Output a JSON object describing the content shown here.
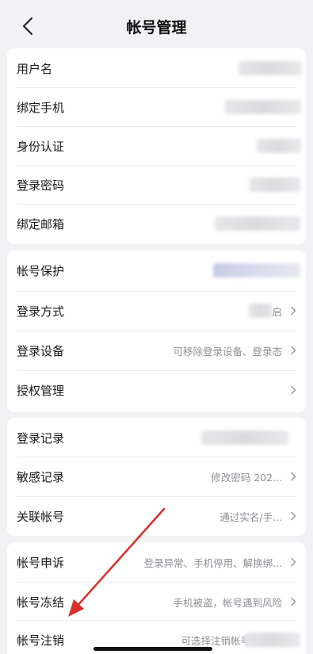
{
  "header": {
    "title": "帐号管理",
    "back_icon": "chevron-left-icon"
  },
  "groups": [
    {
      "rows": [
        {
          "label": "用户名",
          "value": ""
        },
        {
          "label": "绑定手机",
          "value": ""
        },
        {
          "label": "身份认证",
          "value": ""
        },
        {
          "label": "登录密码",
          "value": ""
        },
        {
          "label": "绑定邮箱",
          "value": ""
        }
      ]
    },
    {
      "rows": [
        {
          "label": "帐号保护",
          "value": ""
        },
        {
          "label": "登录方式",
          "value": "启"
        },
        {
          "label": "登录设备",
          "value": "可移除登录设备、登录态"
        },
        {
          "label": "授权管理",
          "value": ""
        }
      ]
    },
    {
      "rows": [
        {
          "label": "登录记录",
          "value": ""
        },
        {
          "label": "敏感记录",
          "value": "修改密码 202..."
        },
        {
          "label": "关联帐号",
          "value": "通过实名/手..."
        }
      ]
    },
    {
      "rows": [
        {
          "label": "帐号申诉",
          "value": "登录异常、手机停用、解换绑..."
        },
        {
          "label": "帐号冻结",
          "value": "手机被盗，帐号遇到风险"
        },
        {
          "label": "帐号注销",
          "value": "可选择注销帐号"
        }
      ]
    }
  ],
  "colors": {
    "background": "#f2f2f4",
    "card": "#ffffff",
    "annotation_arrow": "#d9302b"
  }
}
